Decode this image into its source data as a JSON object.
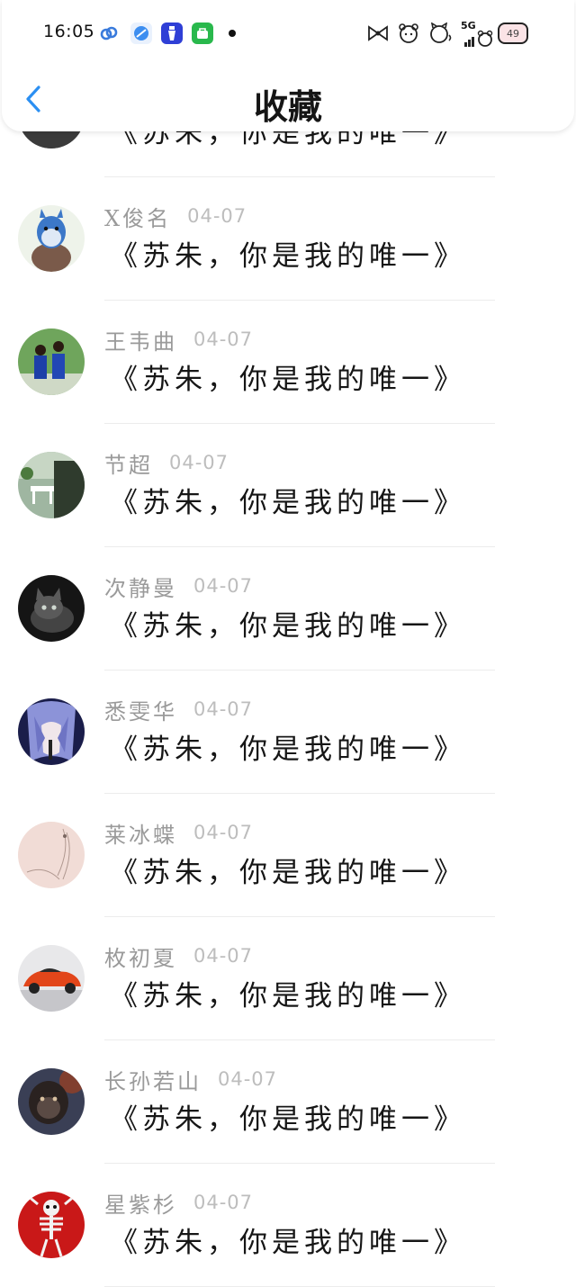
{
  "status_bar": {
    "time": "16:05",
    "network": "5G",
    "battery_level": "49"
  },
  "nav": {
    "title": "收藏",
    "back_icon": "chevron-left-icon"
  },
  "items": [
    {
      "name": "",
      "date": "",
      "message": "《苏朱，你是我的唯一》",
      "avatar": "grayscale-photo"
    },
    {
      "name": "Ⅹ俊名",
      "date": "04-07",
      "message": "《苏朱，你是我的唯一》",
      "avatar": "totoro"
    },
    {
      "name": "王韦曲",
      "date": "04-07",
      "message": "《苏朱，你是我的唯一》",
      "avatar": "couple-photo"
    },
    {
      "name": "节超",
      "date": "04-07",
      "message": "《苏朱，你是我的唯一》",
      "avatar": "garden-chair"
    },
    {
      "name": "次静曼",
      "date": "04-07",
      "message": "《苏朱，你是我的唯一》",
      "avatar": "black-kitten"
    },
    {
      "name": "悉雯华",
      "date": "04-07",
      "message": "《苏朱，你是我的唯一》",
      "avatar": "anime-character"
    },
    {
      "name": "莱冰蝶",
      "date": "04-07",
      "message": "《苏朱，你是我的唯一》",
      "avatar": "pink-sketch"
    },
    {
      "name": "枚初夏",
      "date": "04-07",
      "message": "《苏朱，你是我的唯一》",
      "avatar": "orange-sports-car"
    },
    {
      "name": "长孙若山",
      "date": "04-07",
      "message": "《苏朱，你是我的唯一》",
      "avatar": "gorilla"
    },
    {
      "name": "星紫杉",
      "date": "04-07",
      "message": "《苏朱，你是我的唯一》",
      "avatar": "skeleton-red"
    }
  ]
}
